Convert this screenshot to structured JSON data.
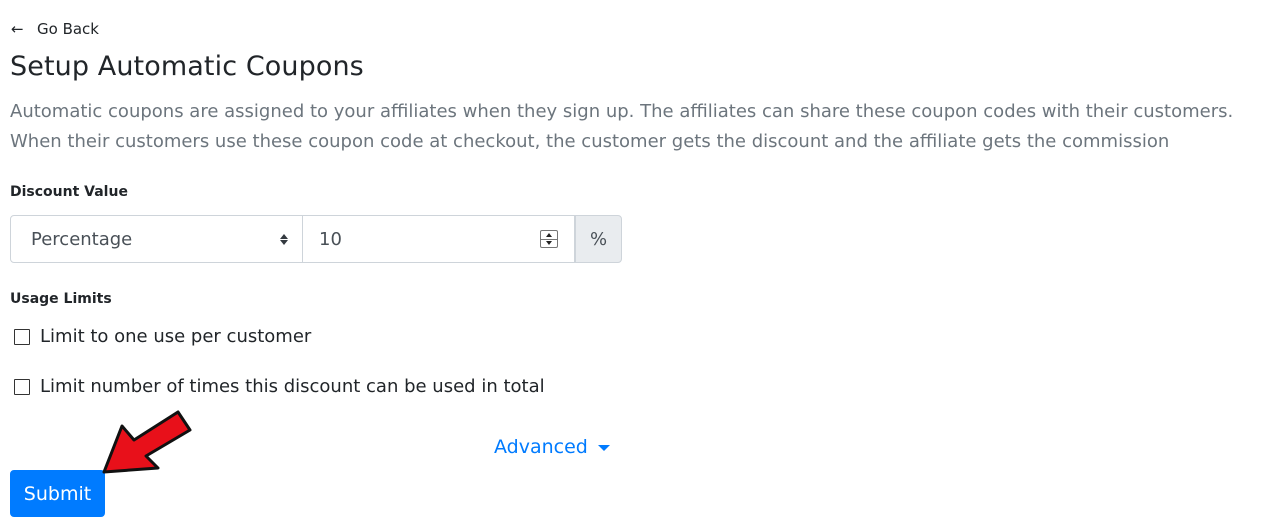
{
  "nav": {
    "back_label": "Go Back"
  },
  "page": {
    "title": "Setup Automatic Coupons",
    "description": "Automatic coupons are assigned to your affiliates when they sign up. The affiliates can share these coupon codes with their customers. When their customers use these coupon code at checkout, the customer gets the discount and the affiliate gets the commission"
  },
  "discount": {
    "label": "Discount Value",
    "type_selected": "Percentage",
    "value": "10",
    "unit": "%"
  },
  "usage": {
    "label": "Usage Limits",
    "options": [
      {
        "label": "Limit to one use per customer",
        "checked": false
      },
      {
        "label": "Limit number of times this discount can be used in total",
        "checked": false
      }
    ]
  },
  "advanced_label": "Advanced",
  "submit_label": "Submit",
  "colors": {
    "primary": "#007bff",
    "muted_text": "#6c757d",
    "annotation_arrow": "#e8101a"
  }
}
